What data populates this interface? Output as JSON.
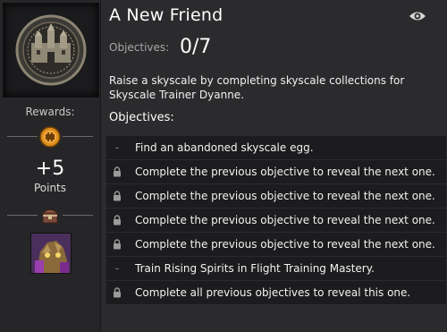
{
  "achievement": {
    "title": "A New Friend",
    "objectives_label": "Objectives:",
    "objectives_count": "0/7",
    "description": "Raise a skyscale by completing skyscale collections for Skyscale Trainer Dyanne.",
    "objectives_heading": "Objectives:"
  },
  "rewards": {
    "label": "Rewards:",
    "points_value": "+5",
    "points_label": "Points"
  },
  "objectives": [
    {
      "marker": "dash",
      "text": "Find an abandoned skyscale egg."
    },
    {
      "marker": "lock",
      "text": "Complete the previous objective to reveal the next one."
    },
    {
      "marker": "lock",
      "text": "Complete the previous objective to reveal the next one."
    },
    {
      "marker": "lock",
      "text": "Complete the previous objective to reveal the next one."
    },
    {
      "marker": "lock",
      "text": "Complete the previous objective to reveal the next one."
    },
    {
      "marker": "dash",
      "text": "Train Rising Spirits in Flight Training Mastery."
    },
    {
      "marker": "lock",
      "text": "Complete all previous objectives to reveal this one."
    }
  ],
  "icons": {
    "emblem": "fortress-emblem-icon",
    "title_icon": "mastery-point-icon",
    "chest": "chest-icon",
    "item": "skyscale-portrait-icon",
    "track": "eye-icon"
  },
  "colors": {
    "background": "#2b2b2d",
    "row": "#1c1c1e",
    "accent_orange": "#e08a1e"
  }
}
